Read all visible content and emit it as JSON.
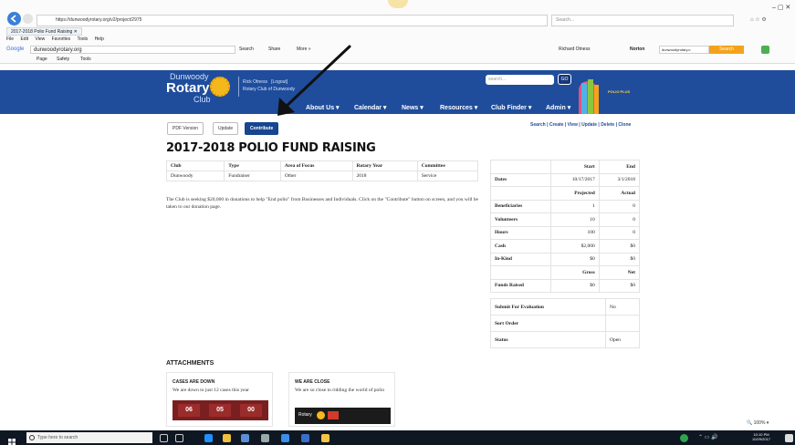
{
  "browser": {
    "url": "https://dunwoodyrotary.org/v2/project/2975",
    "search_placeholder": "Search...",
    "tab_title": "2017-2018 Polio Fund Raising",
    "menu": [
      "File",
      "Edit",
      "View",
      "Favorites",
      "Tools",
      "Help"
    ],
    "google_label": "Google",
    "google_query": "dunwoodyrotary.org",
    "search_btn": "Search",
    "share_btn": "Share",
    "more_btn": "More »",
    "user_label": "Richard Otness",
    "norton_label": "Norton",
    "norton_field": "dunwoodyrotary.o",
    "norton_search": "Search",
    "cmd_items": [
      "Page",
      "Safety",
      "Tools"
    ]
  },
  "site": {
    "brand_top": "Dunwoody",
    "brand_main": "Rotary",
    "brand_sub": "Club",
    "user_name": "Rick Otness",
    "logout": "[Logout]",
    "club_line": "Rotary Club of Dunwoody",
    "search_placeholder": "search...",
    "go": "GO",
    "polio_text": "POLIO PLUS",
    "nav": [
      "About Us ▾",
      "Calendar ▾",
      "News ▾",
      "Resources ▾",
      "Club Finder ▾",
      "Admin ▾"
    ]
  },
  "page": {
    "buttons": {
      "pdf": "PDF Version",
      "update": "Update",
      "contribute": "Contribute"
    },
    "actions": "Search | Create | View | Update | Delete | Clone",
    "title": "2017-2018 POLIO FUND RAISING",
    "info_headers": [
      "Club",
      "Type",
      "Area of Focus",
      "Rotary Year",
      "Committee"
    ],
    "info_values": [
      "Dunwoody",
      "Fundraiser",
      "Other",
      "2018",
      "Service"
    ],
    "description": "The Club is seeking $20,000 in donations to help \"End polio\" from Businesses and Individuals. Click on the \"Contribute\" button on screen, and you will be taken to our donation page.",
    "stats": {
      "start_h": "Start",
      "end_h": "End",
      "dates_l": "Dates",
      "start": "10/17/2017",
      "end": "3/1/2018",
      "proj_h": "Projected",
      "actual_h": "Actual",
      "rows": [
        {
          "label": "Beneficiaries",
          "p": "1",
          "a": "0"
        },
        {
          "label": "Volunteers",
          "p": "10",
          "a": "0"
        },
        {
          "label": "Hours",
          "p": "100",
          "a": "0"
        },
        {
          "label": "Cash",
          "p": "$2,000",
          "a": "$0"
        },
        {
          "label": "In-Kind",
          "p": "$0",
          "a": "$0"
        }
      ],
      "gross_h": "Gross",
      "net_h": "Net",
      "funds_l": "Funds Raised",
      "gross": "$0",
      "net": "$0"
    },
    "eval": {
      "submit_l": "Submit For Evaluation",
      "submit_v": "No",
      "sort_l": "Sort Order",
      "sort_v": "",
      "status_l": "Status",
      "status_v": "Open"
    },
    "attachments_title": "ATTACHMENTS",
    "cards": [
      {
        "title": "CASES ARE DOWN",
        "text": "We are down to just 12 cases this year",
        "nums": [
          "06",
          "05",
          "00"
        ]
      },
      {
        "title": "WE ARE CLOSE",
        "text": "We are so close to ridding the world of polio",
        "img_label": "Rotary"
      }
    ],
    "zoom": "100%"
  },
  "taskbar": {
    "search_placeholder": "Type here to search",
    "time": "10:10 PM",
    "date": "10/29/2017"
  },
  "colors": {
    "brand_blue": "#1f4d9c",
    "rotary_gold": "#f5b81c",
    "contribute": "#17458f"
  }
}
